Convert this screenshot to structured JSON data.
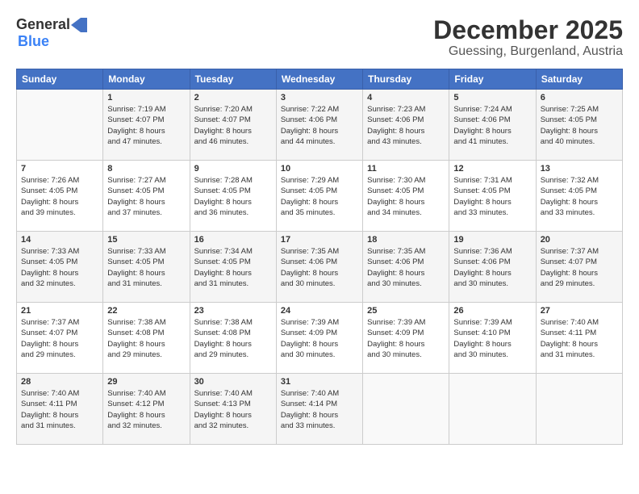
{
  "header": {
    "logo_general": "General",
    "logo_blue": "Blue",
    "month": "December 2025",
    "location": "Guessing, Burgenland, Austria"
  },
  "days_of_week": [
    "Sunday",
    "Monday",
    "Tuesday",
    "Wednesday",
    "Thursday",
    "Friday",
    "Saturday"
  ],
  "weeks": [
    [
      {
        "day": "",
        "info": ""
      },
      {
        "day": "1",
        "info": "Sunrise: 7:19 AM\nSunset: 4:07 PM\nDaylight: 8 hours\nand 47 minutes."
      },
      {
        "day": "2",
        "info": "Sunrise: 7:20 AM\nSunset: 4:07 PM\nDaylight: 8 hours\nand 46 minutes."
      },
      {
        "day": "3",
        "info": "Sunrise: 7:22 AM\nSunset: 4:06 PM\nDaylight: 8 hours\nand 44 minutes."
      },
      {
        "day": "4",
        "info": "Sunrise: 7:23 AM\nSunset: 4:06 PM\nDaylight: 8 hours\nand 43 minutes."
      },
      {
        "day": "5",
        "info": "Sunrise: 7:24 AM\nSunset: 4:06 PM\nDaylight: 8 hours\nand 41 minutes."
      },
      {
        "day": "6",
        "info": "Sunrise: 7:25 AM\nSunset: 4:05 PM\nDaylight: 8 hours\nand 40 minutes."
      }
    ],
    [
      {
        "day": "7",
        "info": "Sunrise: 7:26 AM\nSunset: 4:05 PM\nDaylight: 8 hours\nand 39 minutes."
      },
      {
        "day": "8",
        "info": "Sunrise: 7:27 AM\nSunset: 4:05 PM\nDaylight: 8 hours\nand 37 minutes."
      },
      {
        "day": "9",
        "info": "Sunrise: 7:28 AM\nSunset: 4:05 PM\nDaylight: 8 hours\nand 36 minutes."
      },
      {
        "day": "10",
        "info": "Sunrise: 7:29 AM\nSunset: 4:05 PM\nDaylight: 8 hours\nand 35 minutes."
      },
      {
        "day": "11",
        "info": "Sunrise: 7:30 AM\nSunset: 4:05 PM\nDaylight: 8 hours\nand 34 minutes."
      },
      {
        "day": "12",
        "info": "Sunrise: 7:31 AM\nSunset: 4:05 PM\nDaylight: 8 hours\nand 33 minutes."
      },
      {
        "day": "13",
        "info": "Sunrise: 7:32 AM\nSunset: 4:05 PM\nDaylight: 8 hours\nand 33 minutes."
      }
    ],
    [
      {
        "day": "14",
        "info": "Sunrise: 7:33 AM\nSunset: 4:05 PM\nDaylight: 8 hours\nand 32 minutes."
      },
      {
        "day": "15",
        "info": "Sunrise: 7:33 AM\nSunset: 4:05 PM\nDaylight: 8 hours\nand 31 minutes."
      },
      {
        "day": "16",
        "info": "Sunrise: 7:34 AM\nSunset: 4:05 PM\nDaylight: 8 hours\nand 31 minutes."
      },
      {
        "day": "17",
        "info": "Sunrise: 7:35 AM\nSunset: 4:06 PM\nDaylight: 8 hours\nand 30 minutes."
      },
      {
        "day": "18",
        "info": "Sunrise: 7:35 AM\nSunset: 4:06 PM\nDaylight: 8 hours\nand 30 minutes."
      },
      {
        "day": "19",
        "info": "Sunrise: 7:36 AM\nSunset: 4:06 PM\nDaylight: 8 hours\nand 30 minutes."
      },
      {
        "day": "20",
        "info": "Sunrise: 7:37 AM\nSunset: 4:07 PM\nDaylight: 8 hours\nand 29 minutes."
      }
    ],
    [
      {
        "day": "21",
        "info": "Sunrise: 7:37 AM\nSunset: 4:07 PM\nDaylight: 8 hours\nand 29 minutes."
      },
      {
        "day": "22",
        "info": "Sunrise: 7:38 AM\nSunset: 4:08 PM\nDaylight: 8 hours\nand 29 minutes."
      },
      {
        "day": "23",
        "info": "Sunrise: 7:38 AM\nSunset: 4:08 PM\nDaylight: 8 hours\nand 29 minutes."
      },
      {
        "day": "24",
        "info": "Sunrise: 7:39 AM\nSunset: 4:09 PM\nDaylight: 8 hours\nand 30 minutes."
      },
      {
        "day": "25",
        "info": "Sunrise: 7:39 AM\nSunset: 4:09 PM\nDaylight: 8 hours\nand 30 minutes."
      },
      {
        "day": "26",
        "info": "Sunrise: 7:39 AM\nSunset: 4:10 PM\nDaylight: 8 hours\nand 30 minutes."
      },
      {
        "day": "27",
        "info": "Sunrise: 7:40 AM\nSunset: 4:11 PM\nDaylight: 8 hours\nand 31 minutes."
      }
    ],
    [
      {
        "day": "28",
        "info": "Sunrise: 7:40 AM\nSunset: 4:11 PM\nDaylight: 8 hours\nand 31 minutes."
      },
      {
        "day": "29",
        "info": "Sunrise: 7:40 AM\nSunset: 4:12 PM\nDaylight: 8 hours\nand 32 minutes."
      },
      {
        "day": "30",
        "info": "Sunrise: 7:40 AM\nSunset: 4:13 PM\nDaylight: 8 hours\nand 32 minutes."
      },
      {
        "day": "31",
        "info": "Sunrise: 7:40 AM\nSunset: 4:14 PM\nDaylight: 8 hours\nand 33 minutes."
      },
      {
        "day": "",
        "info": ""
      },
      {
        "day": "",
        "info": ""
      },
      {
        "day": "",
        "info": ""
      }
    ]
  ]
}
